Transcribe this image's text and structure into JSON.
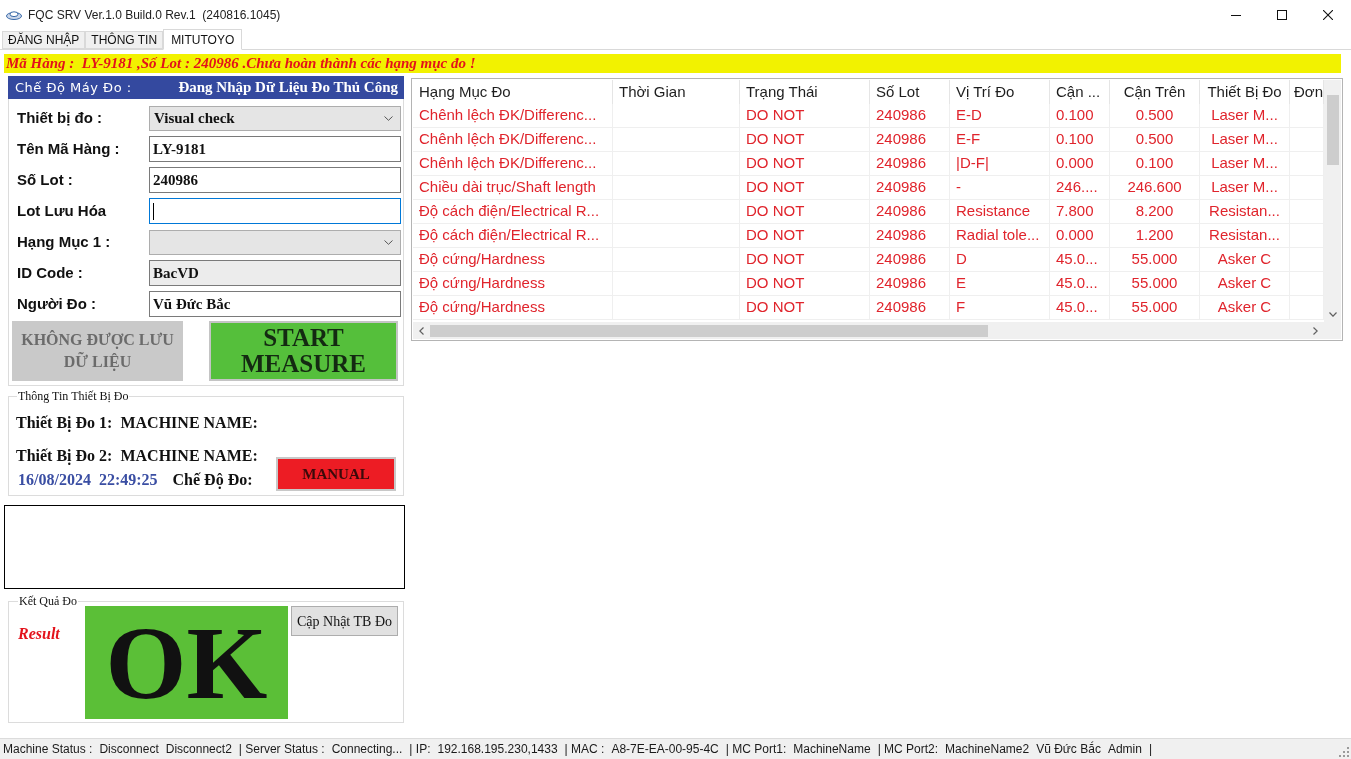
{
  "window": {
    "title": "FQC SRV Ver.1.0 Build.0 Rev.1  (240816.1045)"
  },
  "tabs": [
    {
      "label": "ĐĂNG NHẬP",
      "selected": false
    },
    {
      "label": "THÔNG TIN",
      "selected": false
    },
    {
      "label": "MITUTOYO",
      "selected": true
    }
  ],
  "banner": {
    "text": "Mã Hàng :  LY-9181 ,Số Lot : 240986 .Chưa hoàn thành các hạng mục đo !"
  },
  "mode_header": {
    "label": "Chế Độ Máy Đo :",
    "value": "Đang Nhập Dữ Liệu Đo Thủ Công"
  },
  "form": {
    "fields": [
      {
        "kind": "dropdown",
        "label": "Thiết bị đo :",
        "value": "Visual check",
        "focused": false
      },
      {
        "kind": "input",
        "label": "Tên Mã Hàng :",
        "value": "LY-9181",
        "focused": false
      },
      {
        "kind": "input",
        "label": "Số Lot :",
        "value": "240986",
        "focused": false
      },
      {
        "kind": "input",
        "label": "Lot Lưu Hóa",
        "focused": true
      },
      {
        "kind": "dropdown",
        "label": "Hạng Mục 1 :",
        "focused": false
      },
      {
        "kind": "readonly",
        "label": "ID Code :",
        "value": "BacVD",
        "focused": false
      },
      {
        "kind": "input",
        "label": "Người Đo :",
        "value": "Vũ Đức Bắc",
        "focused": false
      }
    ],
    "buttons": [
      {
        "label": "KHÔNG ĐƯỢC LƯU DỮ LIỆU",
        "disabled": true
      },
      {
        "label": "START MEASURE",
        "disabled": false
      }
    ]
  },
  "device_info": {
    "title": "Thông Tin Thiết Bị Đo",
    "devices": [
      {
        "label": "Thiết Bị Đo 1:",
        "name": "MACHINE NAME:"
      },
      {
        "label": "Thiết Bị Đo 2:",
        "name": "MACHINE NAME:"
      }
    ],
    "date": "16/08/2024",
    "time": "22:49:25",
    "mode_label": "Chế Độ Đo:",
    "mode_button": "MANUAL"
  },
  "result": {
    "title": "Kết Quả Đo",
    "label": "Result",
    "value": "OK",
    "passed": true,
    "button": "Cập Nhật TB Đo"
  },
  "table": {
    "columns": [
      "Hạng Mục Đo",
      "Thời Gian",
      "Trạng Thái",
      "Số Lot",
      "Vị Trí Đo",
      "Cận ...",
      "Cận Trên",
      "Thiết Bị Đo",
      "Đơn"
    ],
    "rows": [
      {
        "item": "Chênh lệch ĐK/Differenc...",
        "status": "DO NOT",
        "lot": "240986",
        "position": "E-D",
        "column_6": "0.100",
        "upper_limit": "0.500",
        "device": "Laser M..."
      },
      {
        "item": "Chênh lệch ĐK/Differenc...",
        "status": "DO NOT",
        "lot": "240986",
        "position": "E-F",
        "column_6": "0.100",
        "upper_limit": "0.500",
        "device": "Laser M..."
      },
      {
        "item": "Chênh lệch ĐK/Differenc...",
        "status": "DO NOT",
        "lot": "240986",
        "position": "|D-F|",
        "column_6": "0.000",
        "upper_limit": "0.100",
        "device": "Laser M..."
      },
      {
        "item": "Chiều dài trục/Shaft length",
        "status": "DO NOT",
        "lot": "240986",
        "position": "-",
        "column_6": "246....",
        "upper_limit": "246.600",
        "device": "Laser M..."
      },
      {
        "item": "Độ cách điện/Electrical R...",
        "status": "DO NOT",
        "lot": "240986",
        "position": "Resistance",
        "column_6": "7.800",
        "upper_limit": "8.200",
        "device": "Resistan..."
      },
      {
        "item": "Độ cách điện/Electrical R...",
        "status": "DO NOT",
        "lot": "240986",
        "position": "Radial tole...",
        "column_6": "0.000",
        "upper_limit": "1.200",
        "device": "Resistan..."
      },
      {
        "item": "Độ cứng/Hardness",
        "status": "DO NOT",
        "lot": "240986",
        "position": "D",
        "column_6": "45.0...",
        "upper_limit": "55.000",
        "device": "Asker C"
      },
      {
        "item": "Độ cứng/Hardness",
        "status": "DO NOT",
        "lot": "240986",
        "position": "E",
        "column_6": "45.0...",
        "upper_limit": "55.000",
        "device": "Asker C"
      },
      {
        "item": "Độ cứng/Hardness",
        "status": "DO NOT",
        "lot": "240986",
        "position": "F",
        "column_6": "45.0...",
        "upper_limit": "55.000",
        "device": "Asker C"
      }
    ]
  },
  "status_bar": {
    "items": [
      "Machine Status :",
      "Disconnect",
      "Disconnect2",
      "| Server Status :",
      "Connecting...",
      "| IP:",
      "192.168.195.230,1433",
      "| MAC :",
      "A8-7E-EA-00-95-4C",
      "| MC Port1:",
      "MachineName",
      "| MC Port2:",
      "MachineName2",
      "Vũ Đức Bắc",
      "Admin",
      "|"
    ]
  }
}
